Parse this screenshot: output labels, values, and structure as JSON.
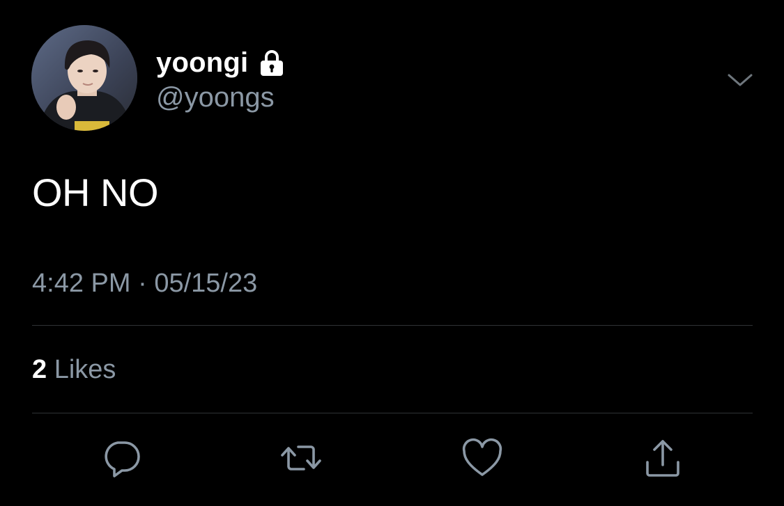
{
  "tweet": {
    "author": {
      "display_name": "yoongi",
      "handle": "@yoongs",
      "protected_icon": "lock-icon",
      "avatar": "avatar-photo"
    },
    "menu_icon": "chevron-down-icon",
    "text": "OH NO",
    "time": "4:42 PM",
    "separator": "·",
    "date": "05/15/23",
    "likes": {
      "count": "2",
      "label": "Likes"
    },
    "actions": [
      {
        "icon": "reply-icon"
      },
      {
        "icon": "retweet-icon"
      },
      {
        "icon": "like-icon"
      },
      {
        "icon": "share-icon"
      }
    ]
  },
  "colors": {
    "background": "#000000",
    "primary_text": "#ffffff",
    "secondary_text": "#8b98a5",
    "divider": "#2f3336"
  }
}
